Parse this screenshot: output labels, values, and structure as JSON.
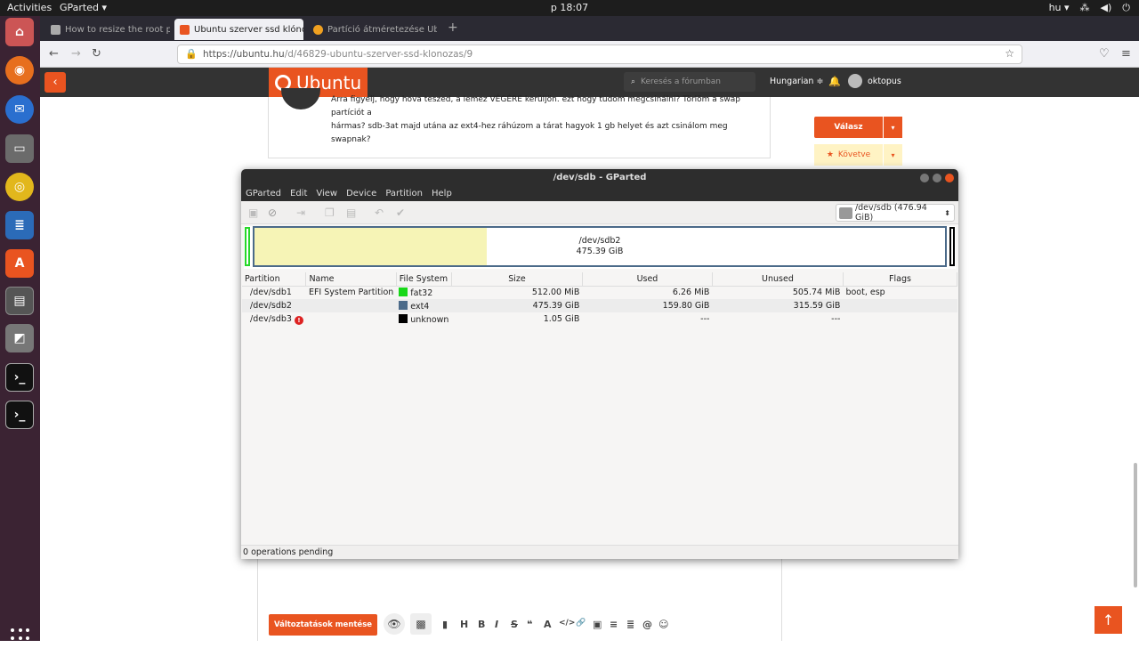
{
  "topbar": {
    "activities": "Activities",
    "app": "GParted ▾",
    "clock": "p 18:07",
    "lang": "hu ▾",
    "tray_icons": [
      "network-icon",
      "volume-icon",
      "power-icon"
    ]
  },
  "dock": {
    "items": [
      "firefox",
      "thunderbird",
      "files",
      "rhythmbox",
      "libreoffice-writer",
      "software-center",
      "gparted",
      "disk-usage",
      "terminal",
      "terminal"
    ]
  },
  "browser": {
    "tabs": [
      {
        "label": "How to resize the root pa",
        "close": "×",
        "active": false
      },
      {
        "label": "Ubuntu szerver ssd klónoz",
        "close": "×",
        "active": true
      },
      {
        "label": "Partíció átméretezése Ub",
        "close": "×",
        "active": false
      }
    ],
    "new_tab": "+",
    "url_host": "https://ubuntu.hu",
    "url_path": "/d/46829-ubuntu-szerver-ssd-klonozas/9"
  },
  "site": {
    "logo": "Ubuntu",
    "search_placeholder": "Keresés a fórumban",
    "language": "Hungarian ≑",
    "username": "oktopus"
  },
  "post": {
    "line1": "Arra figyelj, hogy hova teszed, a lemez VÉGÉRE kerüljön. ezt hogy tudom megcsinálni? Törlöm a swap partíciót a",
    "line2": "hármas? sdb-3at majd utána az ext4-hez ráhúzom a tárat hagyok 1 gb helyet és azt csinálom meg swapnak?"
  },
  "actions": {
    "reply": "Válasz",
    "follow": "Követve",
    "caret": "▾",
    "star": "★"
  },
  "editor": {
    "save": "Változtatások mentése",
    "format_icons": [
      "H",
      "B",
      "I",
      "S",
      "❝",
      "A",
      "</>",
      "🔗",
      "▣",
      "≡",
      "≣",
      "@",
      "☺"
    ]
  },
  "scroll_top": "↑",
  "gparted": {
    "title": "/dev/sdb - GParted",
    "menu": [
      "GParted",
      "Edit",
      "View",
      "Device",
      "Partition",
      "Help"
    ],
    "device": "/dev/sdb  (476.94 GiB)",
    "map": {
      "sdb2_name": "/dev/sdb2",
      "sdb2_size": "475.39 GiB",
      "sdb2_used_fraction": 0.336
    },
    "columns": [
      "Partition",
      "Name",
      "File System",
      "Size",
      "Used",
      "Unused",
      "Flags"
    ],
    "rows": [
      {
        "partition": "/dev/sdb1",
        "name": "EFI System Partition",
        "fs": "fat32",
        "fs_color": "#18d818",
        "size": "512.00 MiB",
        "used": "6.26 MiB",
        "unused": "505.74 MiB",
        "flags": "boot, esp",
        "warn": ""
      },
      {
        "partition": "/dev/sdb2",
        "name": "",
        "fs": "ext4",
        "fs_color": "#4b6a89",
        "size": "475.39 GiB",
        "used": "159.80 GiB",
        "unused": "315.59 GiB",
        "flags": "",
        "warn": ""
      },
      {
        "partition": "/dev/sdb3",
        "name": "",
        "fs": "unknown",
        "fs_color": "#000000",
        "size": "1.05 GiB",
        "used": "---",
        "unused": "---",
        "flags": "",
        "warn": "!"
      }
    ],
    "status": "0 operations pending"
  }
}
